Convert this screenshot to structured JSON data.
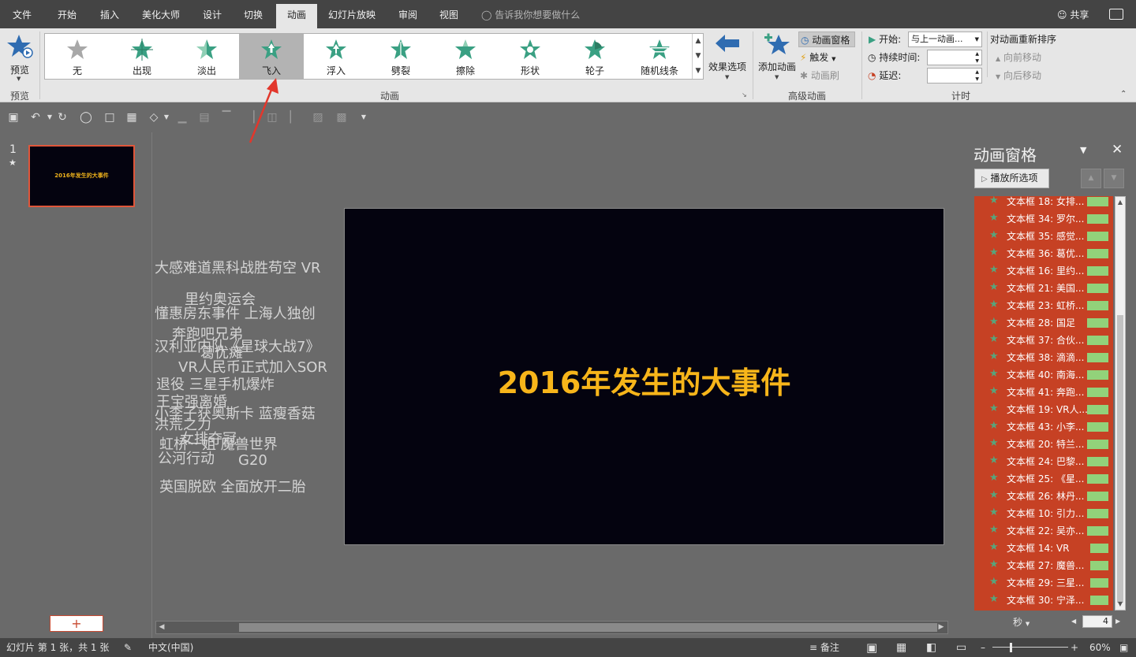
{
  "tabs": [
    "文件",
    "开始",
    "插入",
    "美化大师",
    "设计",
    "切换",
    "动画",
    "幻灯片放映",
    "审阅",
    "视图"
  ],
  "active_tab": "动画",
  "tell_me": "告诉我你想要做什么",
  "share": "共享",
  "ribbon": {
    "preview": {
      "label": "预览",
      "group": "预览"
    },
    "gallery": {
      "group": "动画",
      "items": [
        "无",
        "出现",
        "淡出",
        "飞入",
        "浮入",
        "劈裂",
        "擦除",
        "形状",
        "轮子",
        "随机线条"
      ],
      "selected": "飞入"
    },
    "effect_options": "效果选项",
    "advanced": {
      "group": "高级动画",
      "add_animation": "添加动画",
      "animation_pane": "动画窗格",
      "trigger": "触发",
      "animation_painter": "动画刷"
    },
    "timing": {
      "group": "计时",
      "start_label": "开始:",
      "start_value": "与上一动画...",
      "duration_label": "持续时间:",
      "delay_label": "延迟:",
      "reorder_title": "对动画重新排序",
      "move_earlier": "向前移动",
      "move_later": "向后移动"
    }
  },
  "thumbnail": {
    "number": "1",
    "star": "★",
    "title": "2016年发生的大事件"
  },
  "slide": {
    "title": "2016年发生的大事件"
  },
  "offslide_words": [
    "大感难道黑科战胜苟空 VR",
    "里约奥运会",
    "懂惠房东事件 上海人独创",
    "奔跑吧兄弟",
    "汉利亚内队《星球大战7》",
    "葛优瘫",
    "VR人民币正式加入SOR",
    "退役 三星手机爆炸",
    "王宝强离婚",
    "小李子获奥斯卡 蓝瘦香菇",
    "洪荒之力",
    "女排夺冠",
    "虹桥一姐 魔兽世界",
    "G20",
    "公河行动",
    "英国脱欧 全面放开二胎"
  ],
  "anim_pane": {
    "title": "动画窗格",
    "play_selected": "播放所选项",
    "items": [
      "文本框 18: 女排...",
      "文本框 34: 罗尔...",
      "文本框 35: 感觉...",
      "文本框 36: 葛优...",
      "文本框 16: 里约...",
      "文本框 21: 美国...",
      "文本框 23: 虹桥...",
      "文本框 28: 国足",
      "文本框 37: 合伙...",
      "文本框 38: 滴滴...",
      "文本框 40: 南海...",
      "文本框 41: 奔跑...",
      "文本框 19: VR人...",
      "文本框 43: 小李...",
      "文本框 20: 特兰...",
      "文本框 24: 巴黎...",
      "文本框 25: 《星...",
      "文本框 26: 林丹...",
      "文本框 10: 引力...",
      "文本框 22: 吴亦...",
      "文本框 14: VR",
      "文本框 27: 魔兽...",
      "文本框 29: 三星...",
      "文本框 30: 宁泽..."
    ],
    "seconds": "秒",
    "zoom": "4"
  },
  "statusbar": {
    "slide_info": "幻灯片 第 1 张，共 1 张",
    "language": "中文(中国)",
    "notes": "备注",
    "zoom": "60%"
  },
  "colors": {
    "accent": "#c64124",
    "slide_bg": "#04030f",
    "title": "#f7b51a",
    "anim_bar": "#92d27a"
  }
}
